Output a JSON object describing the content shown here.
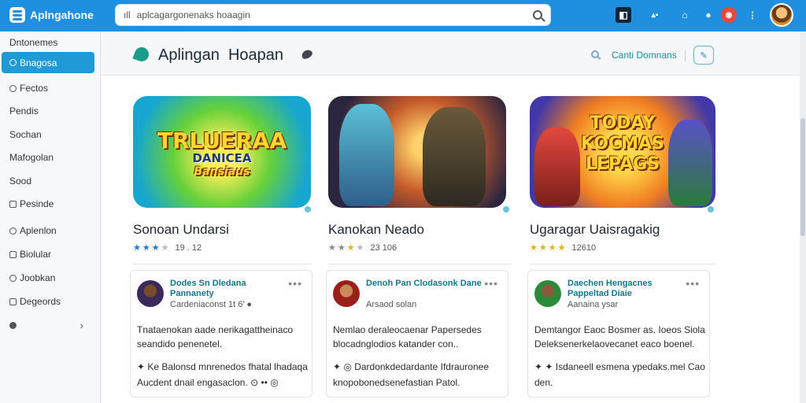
{
  "app": {
    "name": "Aplngahone"
  },
  "search": {
    "prefix": "ıll",
    "value": "aplcagargonenaks hoaagin"
  },
  "header": {
    "title": "Aplingan",
    "subtitle": "Hoapan",
    "action_label": "Canti Domnans",
    "action_icon": "edit-icon"
  },
  "sidebar": {
    "heading": "Dntonemes",
    "items": [
      {
        "label": "Bnagosa",
        "active": true
      },
      {
        "label": "Fectos"
      },
      {
        "label": "Pendis"
      },
      {
        "label": "Sochan"
      },
      {
        "label": "Mafogolan"
      },
      {
        "label": "Sood"
      },
      {
        "label": "Pesinde"
      },
      {
        "label": "Aplenlon"
      },
      {
        "label": "Biolular"
      },
      {
        "label": "Joobkan"
      },
      {
        "label": "Degeords"
      },
      {
        "label": ""
      }
    ]
  },
  "games": [
    {
      "title": "Sonoan  Undarsi",
      "rating_text": "19 . 12",
      "art_line1": "TRLUERAA",
      "art_line2": "DANICEA",
      "art_line3": "Bansiaus",
      "colors": [
        "#1f7ad6",
        "#1f7ad6",
        "#1f7ad6",
        "#bbbbbb"
      ]
    },
    {
      "title": "Kanokan Neado",
      "rating_text": "23 106",
      "art_line1": "",
      "art_line2": "",
      "art_line3": "",
      "colors": [
        "#888888",
        "#888888",
        "#e6b400",
        "#bbbbbb"
      ]
    },
    {
      "title": "Ugaragar Uaisragakig",
      "rating_text": "12610",
      "art_line1": "TODAY",
      "art_line2": "KOCMAS",
      "art_line3": "LEPAGS",
      "colors": [
        "#e6b400",
        "#e6b400",
        "#e6b400",
        "#e6b400"
      ]
    }
  ],
  "posts": [
    {
      "name": "Dodes Sn Dledana Pannanety",
      "meta": "Cardeniaconst 1t 6’ ●",
      "body": "Tnataenokan aade nerikagattheinaco seandido penenetel.",
      "foot": "Balonsd mnrenedos fhatal lhadaqa Aucdent dnail engasaclon.",
      "foot_icon": "✦ Ke",
      "foot_tail": "⊙ •• ◎"
    },
    {
      "name": "Denoh Pan Clodasonk Dane",
      "meta": "Arsaod solan",
      "body": "Nemlao deraleocaenar Papersedes blocadnglodios katander con..",
      "foot": "Dardonkdedardante Ifdrauronee knopobonedsenefastian Patol.",
      "foot_icon": "✦ ◎",
      "foot_tail": ""
    },
    {
      "name": "Daechen Hengacnes Pappeltad Diaie",
      "meta": "Aanaina ysar",
      "body": "Demtangor Eaoc Bosmer as. Ioeos Siola Deleksenerkelaovecanet eaco boenel.",
      "foot": "Isdaneell esmena ypedaks.mel Cao den.",
      "foot_icon": "✦ ✦",
      "foot_tail": ""
    }
  ]
}
